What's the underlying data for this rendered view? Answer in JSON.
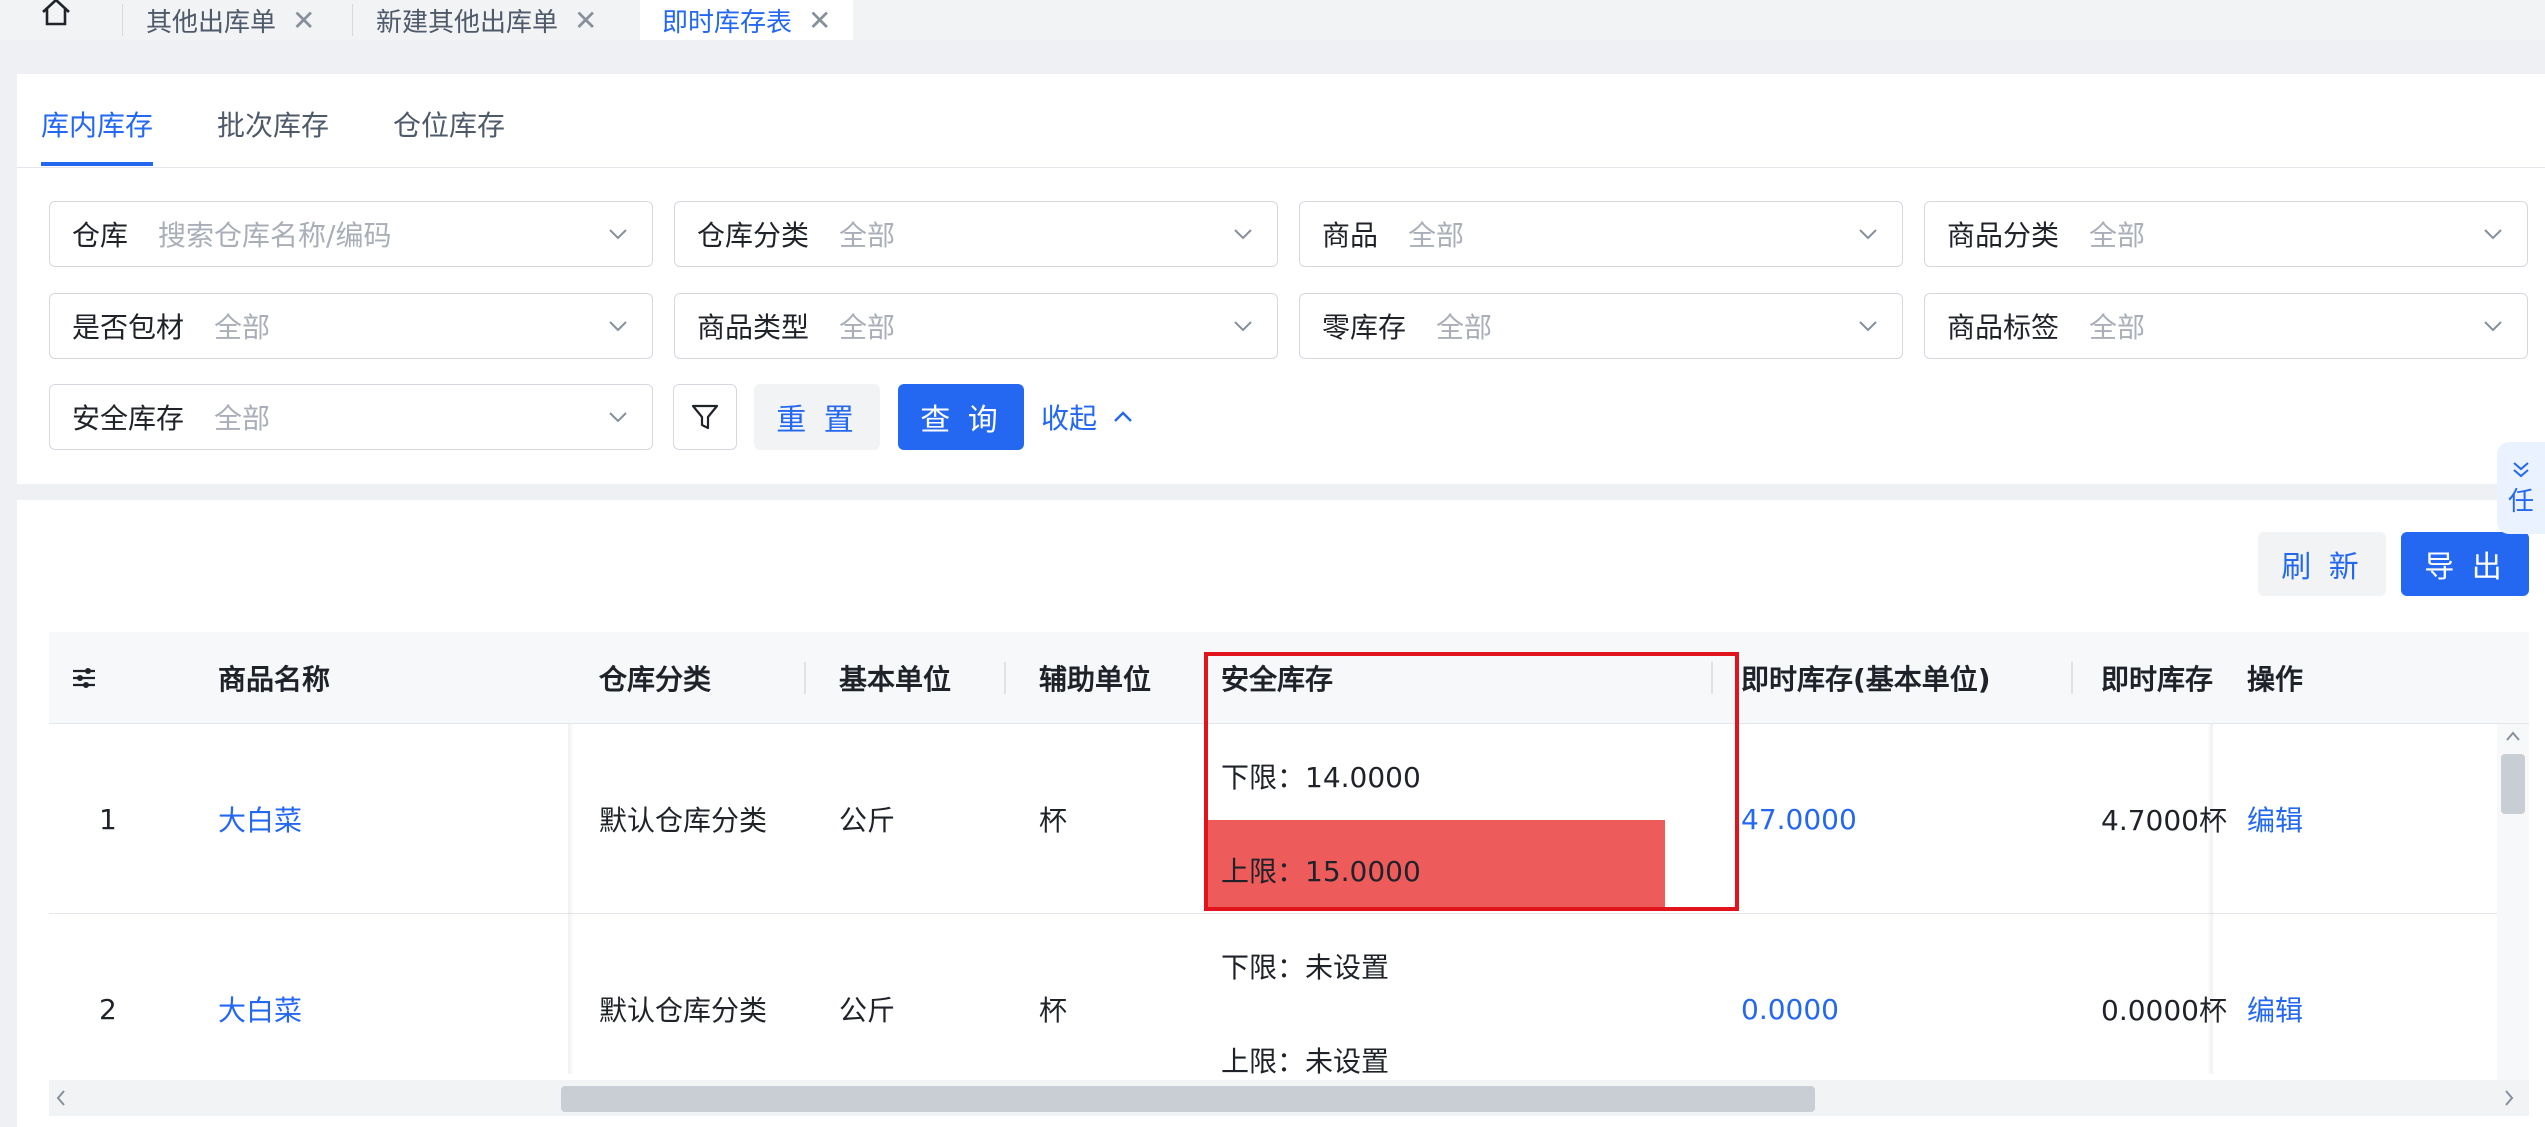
{
  "top_tabs": [
    {
      "label": "其他出库单",
      "closable": true
    },
    {
      "label": "新建其他出库单",
      "closable": true
    },
    {
      "label": "即时库存表",
      "closable": true,
      "active": true
    }
  ],
  "sub_tabs": [
    {
      "label": "库内库存",
      "active": true
    },
    {
      "label": "批次库存"
    },
    {
      "label": "仓位库存"
    }
  ],
  "filters": [
    {
      "label": "仓库",
      "placeholder": "搜索仓库名称/编码"
    },
    {
      "label": "仓库分类",
      "placeholder": "全部"
    },
    {
      "label": "商品",
      "placeholder": "全部"
    },
    {
      "label": "商品分类",
      "placeholder": "全部"
    },
    {
      "label": "是否包材",
      "placeholder": "全部"
    },
    {
      "label": "商品类型",
      "placeholder": "全部"
    },
    {
      "label": "零库存",
      "placeholder": "全部"
    },
    {
      "label": "商品标签",
      "placeholder": "全部"
    },
    {
      "label": "安全库存",
      "placeholder": "全部"
    }
  ],
  "actions": {
    "reset": "重 置",
    "query": "查 询",
    "collapse": "收起",
    "refresh": "刷 新",
    "export": "导 出"
  },
  "table": {
    "headers": {
      "name": "商品名称",
      "wh_category": "仓库分类",
      "base_unit": "基本单位",
      "aux_unit": "辅助单位",
      "safety": "安全库存",
      "stock_base": "即时库存(基本单位)",
      "stock": "即时库存",
      "ops": "操作"
    },
    "rows": [
      {
        "index": "1",
        "name": "大白菜",
        "wh_category": "默认仓库分类",
        "base_unit": "公斤",
        "aux_unit": "杯",
        "lower": "下限：14.0000",
        "upper": "上限：15.0000",
        "stock_base": "47.0000",
        "stock": "4.7000杯",
        "op": "编辑"
      },
      {
        "index": "2",
        "name": "大白菜",
        "wh_category": "默认仓库分类",
        "base_unit": "公斤",
        "aux_unit": "杯",
        "lower": "下限：未设置",
        "upper": "上限：未设置",
        "stock_base": "0.0000",
        "stock": "0.0000杯",
        "op": "编辑"
      }
    ]
  },
  "side_widget": {
    "label": "任"
  },
  "colors": {
    "primary": "#2468f2",
    "highlight": "#ee5b5b",
    "annotation": "#e1141e"
  }
}
